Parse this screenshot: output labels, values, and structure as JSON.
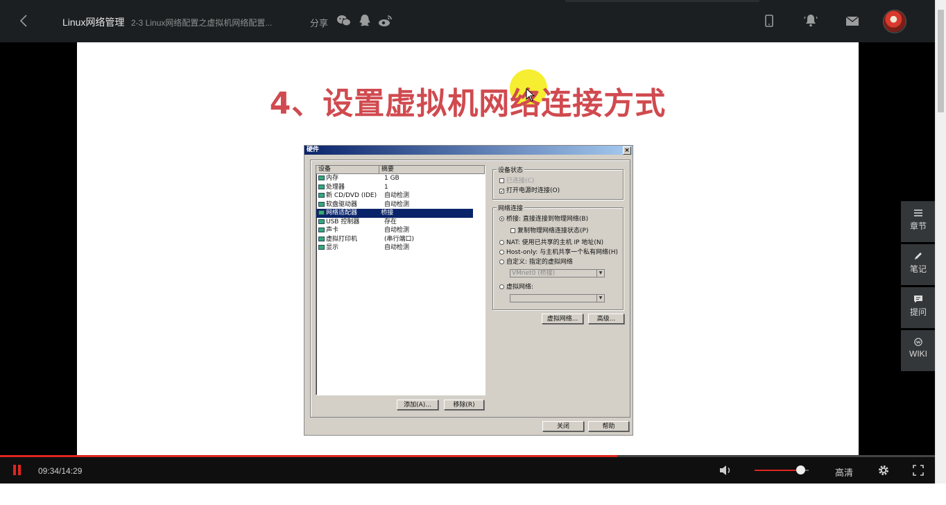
{
  "header": {
    "course_title": "Linux网络管理",
    "lesson_title": "2-3 Linux网络配置之虚拟机网络配置...",
    "share_label": "分享"
  },
  "slide": {
    "title": "4、设置虚拟机网络连接方式",
    "dialog": {
      "title": "硬件",
      "close_glyph": "×",
      "columns": [
        "设备",
        "摘要"
      ],
      "devices": [
        {
          "name": "内存",
          "summary": "1 GB"
        },
        {
          "name": "处理器",
          "summary": "1"
        },
        {
          "name": "新 CD/DVD (IDE)",
          "summary": "自动检测"
        },
        {
          "name": "软盘驱动器",
          "summary": "自动检测"
        },
        {
          "name": "网络适配器",
          "summary": "桥接"
        },
        {
          "name": "USB 控制器",
          "summary": "存在"
        },
        {
          "name": "声卡",
          "summary": "自动检测"
        },
        {
          "name": "虚拟打印机",
          "summary": "(串行端口)"
        },
        {
          "name": "显示",
          "summary": "自动检测"
        }
      ],
      "device_status_label": "设备状态",
      "connected_label": "已连接(C)",
      "connect_on_power_label": "打开电源时连接(O)",
      "network_conn_label": "网络连接",
      "bridged_label": "桥接: 直接连接到物理网络(B)",
      "replicate_label": "复制物理网络连接状态(P)",
      "nat_label": "NAT: 使用已共享的主机 IP 地址(N)",
      "hostonly_label": "Host-only: 与主机共享一个私有网络(H)",
      "custom_label": "自定义: 指定的虚拟网络",
      "vmnet_select": "VMnet0 (桥接)",
      "lan_segment_label": "虚拟网络:",
      "lan_select": "",
      "vnet_button": "虚拟网络...",
      "advanced_button": "高级...",
      "add_button": "添加(A)...",
      "remove_button": "移除(R)",
      "close_button": "关闭",
      "help_button": "帮助",
      "check_glyph": "✓"
    }
  },
  "player": {
    "time": "09:34/14:29",
    "progress": 0.66,
    "volume": 0.85,
    "quality": "高清"
  },
  "side_panel": {
    "chapters": "章节",
    "notes": "笔记",
    "questions": "提问",
    "wiki": "WIKI"
  },
  "colors": {
    "accent": "#e0251f",
    "slide_title": "#d04a4f",
    "topbar": "#1c1f21",
    "side_button": "#34373a"
  }
}
